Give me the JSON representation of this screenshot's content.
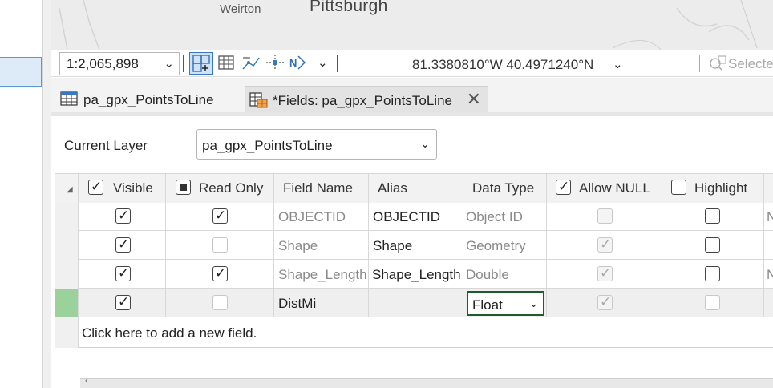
{
  "map": {
    "town_label": "Weirton",
    "city_label": "Pittsburgh"
  },
  "statusbar": {
    "scale": "1:2,065,898",
    "coordinates": "81.3380810°W 40.4971240°N",
    "selected_label": "Selecte",
    "tools": [
      "fixed-zoom-icon",
      "grid-icon",
      "snapping-icon",
      "guide-icon",
      "north-arrow-icon"
    ]
  },
  "tabs": [
    {
      "label": "pa_gpx_PointsToLine",
      "icon": "table-icon",
      "active": false
    },
    {
      "label": "*Fields: pa_gpx_PointsToLine",
      "icon": "fields-icon",
      "active": true,
      "closable": true
    }
  ],
  "fields_view": {
    "current_layer_label": "Current Layer",
    "current_layer_value": "pa_gpx_PointsToLine",
    "columns": [
      "Visible",
      "Read Only",
      "Field Name",
      "Alias",
      "Data Type",
      "Allow NULL",
      "Highlight"
    ],
    "rows": [
      {
        "visible": true,
        "read_only": true,
        "field_name": "OBJECTID",
        "alias": "OBJECTID",
        "data_type": "Object ID",
        "allow_null": false,
        "allow_null_disabled": true,
        "highlight": false,
        "extra": "N",
        "editable_name": false
      },
      {
        "visible": true,
        "read_only": false,
        "field_name": "Shape",
        "alias": "Shape",
        "data_type": "Geometry",
        "allow_null": true,
        "allow_null_disabled": true,
        "highlight": false,
        "extra": "",
        "editable_name": false
      },
      {
        "visible": true,
        "read_only": true,
        "field_name": "Shape_Length",
        "alias": "Shape_Length",
        "data_type": "Double",
        "allow_null": true,
        "allow_null_disabled": true,
        "highlight": false,
        "extra": "N",
        "editable_name": false
      },
      {
        "visible": true,
        "read_only": false,
        "field_name": "DistMi",
        "alias": "",
        "data_type": "Float",
        "allow_null": true,
        "allow_null_disabled": true,
        "highlight": false,
        "extra": "",
        "editable_name": true,
        "active": true
      }
    ],
    "add_field_text": "Click here to add a new field."
  }
}
